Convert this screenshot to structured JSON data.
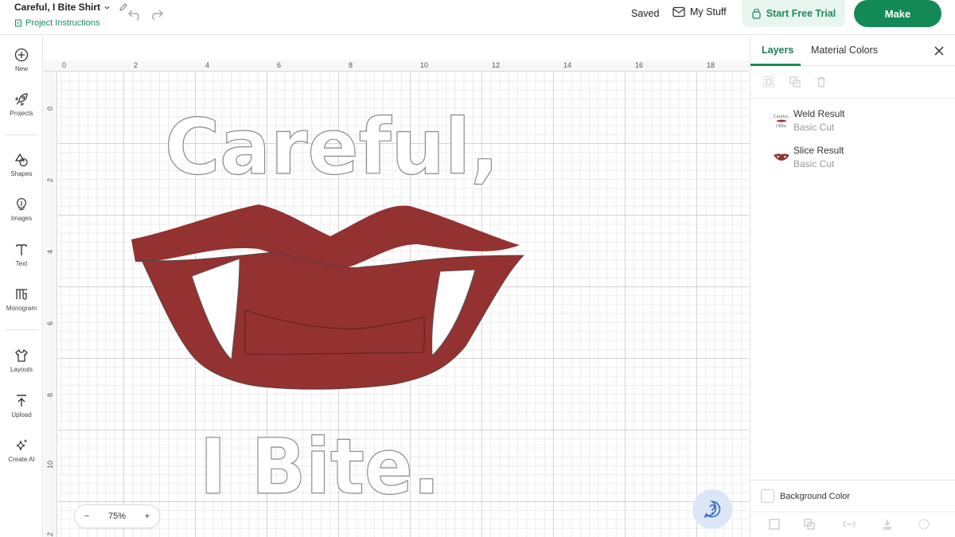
{
  "header": {
    "project_title": "Careful, I Bite Shirt",
    "project_instructions": "Project Instructions",
    "saved_status": "Saved",
    "my_stuff": "My Stuff",
    "trial_button": "Start Free Trial",
    "make_button": "Make"
  },
  "left_toolbar": {
    "items": [
      {
        "label": "New",
        "icon": "plus-circle-icon"
      },
      {
        "label": "Projects",
        "icon": "rocket-icon"
      },
      {
        "label": "Shapes",
        "icon": "shapes-icon"
      },
      {
        "label": "Images",
        "icon": "lightbulb-icon"
      },
      {
        "label": "Text",
        "icon": "text-icon"
      },
      {
        "label": "Monogram",
        "icon": "monogram-icon"
      },
      {
        "label": "Layouts",
        "icon": "shirt-icon"
      },
      {
        "label": "Upload",
        "icon": "upload-icon"
      },
      {
        "label": "Create AI",
        "icon": "sparkle-icon"
      }
    ]
  },
  "canvas": {
    "ruler_top_labels": [
      "0",
      "2",
      "4",
      "6",
      "8",
      "10",
      "12",
      "14",
      "16",
      "18"
    ],
    "ruler_left_labels": [
      "0",
      "2",
      "4",
      "6",
      "8",
      "10",
      "12"
    ],
    "design": {
      "text_line_1": "Careful,",
      "text_line_2": "I Bite.",
      "lips_color": "#943131",
      "outline_color": "#8a8a8a"
    },
    "zoom": {
      "minus": "−",
      "value": "75%",
      "plus": "+"
    },
    "help_icon": "question-chat-icon"
  },
  "right_panel": {
    "tabs": {
      "layers": "Layers",
      "material_colors": "Material Colors"
    },
    "layers": [
      {
        "name": "Weld Result",
        "operation": "Basic Cut"
      },
      {
        "name": "Slice Result",
        "operation": "Basic Cut"
      }
    ],
    "background_color_label": "Background Color"
  },
  "colors": {
    "accent_green": "#138a56",
    "accent_text_green": "#1d8a5c",
    "trial_bg": "#e9f6ef"
  }
}
